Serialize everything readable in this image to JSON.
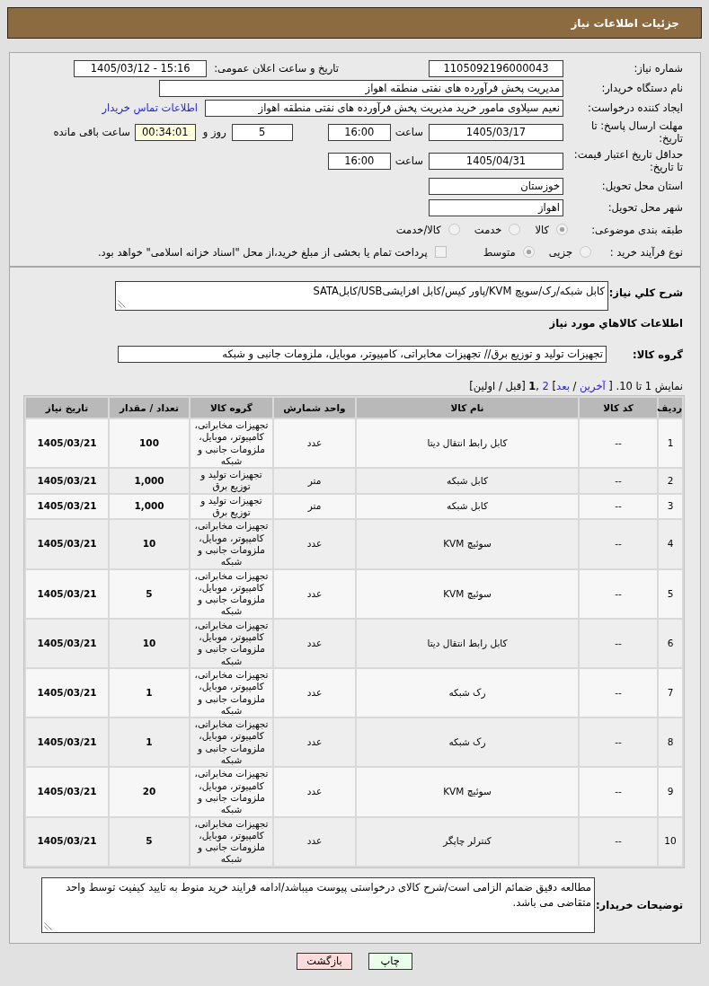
{
  "header": {
    "title": "جزئیات اطلاعات نیاز"
  },
  "details": {
    "need_number": {
      "label": "شماره نیاز:",
      "value": "1105092196000043"
    },
    "announce_datetime": {
      "label": "تاریخ و ساعت اعلان عمومی:",
      "value": "1405/03/12 - 15:16"
    },
    "buyer_org": {
      "label": "نام دستگاه خریدار:",
      "value": "مدیریت پخش فرآورده های نفتی منطقه اهواز"
    },
    "requester": {
      "label": "ایجاد کننده درخواست:",
      "value": "نعیم سیلاوی مامور خرید مدیریت پخش فرآورده های نفتی منطقه اهواز",
      "link": "اطلاعات تماس خریدار"
    },
    "response_deadline": {
      "label": "مهلت ارسال پاسخ: تا تاریخ:",
      "date": "1405/03/17",
      "time_label": "ساعت",
      "time": "16:00",
      "days": "5",
      "days_label": "روز و",
      "remaining": "00:34:01",
      "remaining_label": "ساعت باقی مانده"
    },
    "price_validity": {
      "label": "حداقل تاریخ اعتبار قیمت: تا تاریخ:",
      "date": "1405/04/31",
      "time_label": "ساعت",
      "time": "16:00"
    },
    "province": {
      "label": "استان محل تحویل:",
      "value": "خوزستان"
    },
    "city": {
      "label": "شهر محل تحویل:",
      "value": "اهواز"
    },
    "category": {
      "label": "طبقه بندی موضوعی:",
      "disabled": true,
      "options": [
        {
          "label": "کالا",
          "selected": true
        },
        {
          "label": "خدمت",
          "selected": false
        },
        {
          "label": "کالا/خدمت",
          "selected": false
        }
      ]
    },
    "process_type": {
      "label": "نوع فرآیند خرید :",
      "disabled": true,
      "options": [
        {
          "label": "جزیی",
          "selected": false
        },
        {
          "label": "متوسط",
          "selected": true
        }
      ],
      "treasury_checkbox": {
        "label": "پرداخت تمام یا بخشی از مبلغ خرید،از محل \"اسناد خزانه اسلامی\" خواهد بود.",
        "checked": false,
        "disabled": true
      }
    }
  },
  "need": {
    "description_label": "شرح کلي نياز:",
    "description": "کابل شبکه/رک/سویچ KVM/پاور کیس/کابل افزایشیUSB/کابلSATA",
    "goods_heading": "اطلاعات کالاهاي مورد نياز",
    "group_label": "گروه کالا:",
    "group": "تجهیزات تولید و توزیع برق// تجهیزات مخابراتی، کامپیوتر، موبایل، ملزومات جانبی و شبکه"
  },
  "pagination": {
    "parts": [
      {
        "kind": "text",
        "text": "نمایش 1 تا 10. [ "
      },
      {
        "kind": "link",
        "text": "آخرین"
      },
      {
        "kind": "text",
        "text": " / "
      },
      {
        "kind": "link",
        "text": "بعد"
      },
      {
        "kind": "text",
        "text": "] "
      },
      {
        "kind": "link",
        "text": "2"
      },
      {
        "kind": "text",
        "text": " ,"
      },
      {
        "kind": "current",
        "text": "1"
      },
      {
        "kind": "text",
        "text": " [قبل / اولین]"
      }
    ]
  },
  "table": {
    "columns": [
      "ردیف",
      "کد کالا",
      "نام کالا",
      "واحد شمارش",
      "گروه کالا",
      "تعداد / مقدار",
      "تاریخ نیاز"
    ],
    "rows": [
      [
        "1",
        "--",
        "کابل رابط انتقال دیتا",
        "عدد",
        "تجهیزات مخابراتی، کامپیوتر، موبایل، ملزومات جانبی و شبکه",
        "100",
        "1405/03/21"
      ],
      [
        "2",
        "--",
        "کابل شبکه",
        "متر",
        "تجهیزات تولید و توزیع برق",
        "1,000",
        "1405/03/21"
      ],
      [
        "3",
        "--",
        "کابل شبکه",
        "متر",
        "تجهیزات تولید و توزیع برق",
        "1,000",
        "1405/03/21"
      ],
      [
        "4",
        "--",
        "سوئیچ KVM",
        "عدد",
        "تجهیزات مخابراتی، کامپیوتر، موبایل، ملزومات جانبی و شبکه",
        "10",
        "1405/03/21"
      ],
      [
        "5",
        "--",
        "سوئیچ KVM",
        "عدد",
        "تجهیزات مخابراتی، کامپیوتر، موبایل، ملزومات جانبی و شبکه",
        "5",
        "1405/03/21"
      ],
      [
        "6",
        "--",
        "کابل رابط انتقال دیتا",
        "عدد",
        "تجهیزات مخابراتی، کامپیوتر، موبایل، ملزومات جانبی و شبکه",
        "10",
        "1405/03/21"
      ],
      [
        "7",
        "--",
        "رک شبکه",
        "عدد",
        "تجهیزات مخابراتی، کامپیوتر، موبایل، ملزومات جانبی و شبکه",
        "1",
        "1405/03/21"
      ],
      [
        "8",
        "--",
        "رک شبکه",
        "عدد",
        "تجهیزات مخابراتی، کامپیوتر، موبایل، ملزومات جانبی و شبکه",
        "1",
        "1405/03/21"
      ],
      [
        "9",
        "--",
        "سوئیچ KVM",
        "عدد",
        "تجهیزات مخابراتی، کامپیوتر، موبایل، ملزومات جانبی و شبکه",
        "20",
        "1405/03/21"
      ],
      [
        "10",
        "--",
        "کنترلر چاپگر",
        "عدد",
        "تجهیزات مخابراتی، کامپیوتر، موبایل، ملزومات جانبی و شبکه",
        "5",
        "1405/03/21"
      ]
    ]
  },
  "notes": {
    "label": "توضیحات خریدار:",
    "value": "مطالعه دقیق ضمائم الزامی است/شرح کالای درخواستی پیوست میباشد/ادامه فرایند خرید منوط به تایید کیفیت توسط واحد متقاضی می باشد."
  },
  "buttons": [
    {
      "label": "چاپ",
      "kind": "print"
    },
    {
      "label": "بازگشت",
      "kind": "back"
    }
  ]
}
